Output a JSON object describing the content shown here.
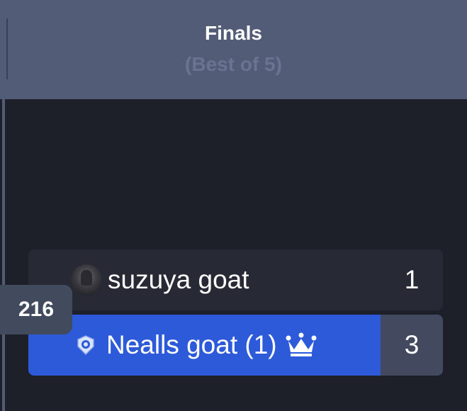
{
  "round": {
    "title": "Finals",
    "subtitle": "(Best of 5)"
  },
  "match": {
    "id": "216",
    "players": [
      {
        "name": "suzuya goat",
        "score": "1",
        "avatar": "profile-photo",
        "winner": false
      },
      {
        "name": "Nealls goat (1)",
        "score": "3",
        "icon": "club-badge-icon",
        "winner": true,
        "winner_icon": "crown-icon"
      }
    ]
  },
  "colors": {
    "header_bg": "#525c77",
    "page_bg": "#1e2029",
    "winner_bg": "#2c5ad9",
    "loser_bg": "#272a35",
    "winner_score_bg": "#434a5f"
  }
}
